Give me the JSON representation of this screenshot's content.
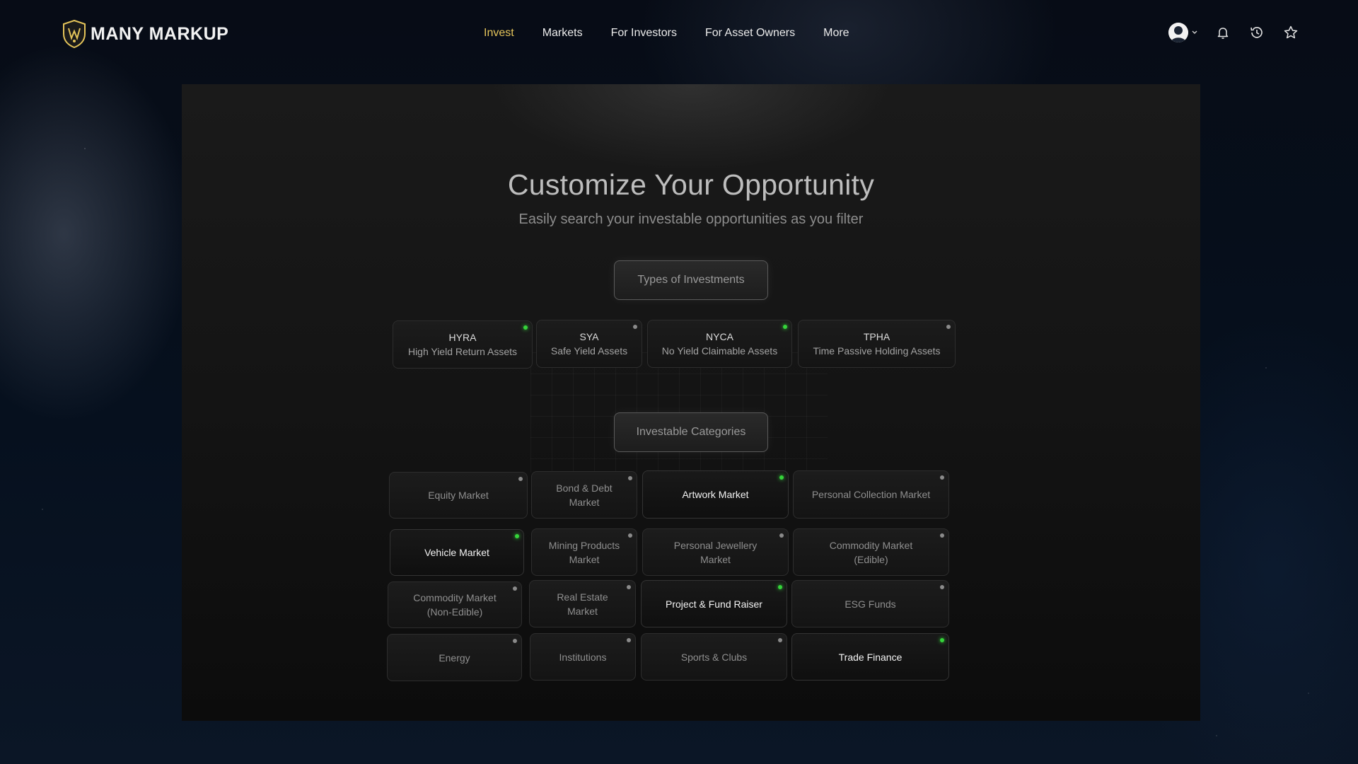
{
  "brand": {
    "name": "MANY MARKUP",
    "accent": "#e4c45a"
  },
  "nav": {
    "items": [
      {
        "label": "Invest",
        "active": true
      },
      {
        "label": "Markets",
        "active": false
      },
      {
        "label": "For Investors",
        "active": false
      },
      {
        "label": "For Asset Owners",
        "active": false
      },
      {
        "label": "More",
        "active": false
      }
    ]
  },
  "header_icons": [
    "avatar",
    "chevron-down-icon",
    "bell-icon",
    "history-icon",
    "star-icon"
  ],
  "hero": {
    "title": "Customize Your Opportunity",
    "subtitle": "Easily search your investable opportunities as you filter"
  },
  "types_section": {
    "label": "Types of Investments",
    "items": [
      {
        "code": "HYRA",
        "desc": "High Yield Return Assets",
        "status": "green"
      },
      {
        "code": "SYA",
        "desc": "Safe Yield Assets",
        "status": "grey"
      },
      {
        "code": "NYCA",
        "desc": "No Yield Claimable Assets",
        "status": "green"
      },
      {
        "code": "TPHA",
        "desc": "Time Passive Holding Assets",
        "status": "grey"
      }
    ]
  },
  "categories_section": {
    "label": "Investable Categories",
    "items": [
      {
        "label": "Equity Market",
        "status": "grey",
        "selected": false
      },
      {
        "label": "Bond & Debt Market",
        "status": "grey",
        "selected": false
      },
      {
        "label": "Artwork Market",
        "status": "green",
        "selected": true
      },
      {
        "label": "Personal Collection Market",
        "status": "grey",
        "selected": false
      },
      {
        "label": "Vehicle Market",
        "status": "green",
        "selected": true
      },
      {
        "label": "Mining Products Market",
        "status": "grey",
        "selected": false
      },
      {
        "label": "Personal Jewellery Market",
        "status": "grey",
        "selected": false
      },
      {
        "label": "Commodity Market (Edible)",
        "status": "grey",
        "selected": false
      },
      {
        "label": "Commodity Market (Non-Edible)",
        "status": "grey",
        "selected": false
      },
      {
        "label": "Real Estate Market",
        "status": "grey",
        "selected": false
      },
      {
        "label": "Project & Fund Raiser",
        "status": "green",
        "selected": true
      },
      {
        "label": "ESG Funds",
        "status": "grey",
        "selected": false
      },
      {
        "label": "Energy",
        "status": "grey",
        "selected": false
      },
      {
        "label": "Institutions",
        "status": "grey",
        "selected": false
      },
      {
        "label": "Sports & Clubs",
        "status": "grey",
        "selected": false
      },
      {
        "label": "Trade Finance",
        "status": "green",
        "selected": true
      }
    ]
  }
}
